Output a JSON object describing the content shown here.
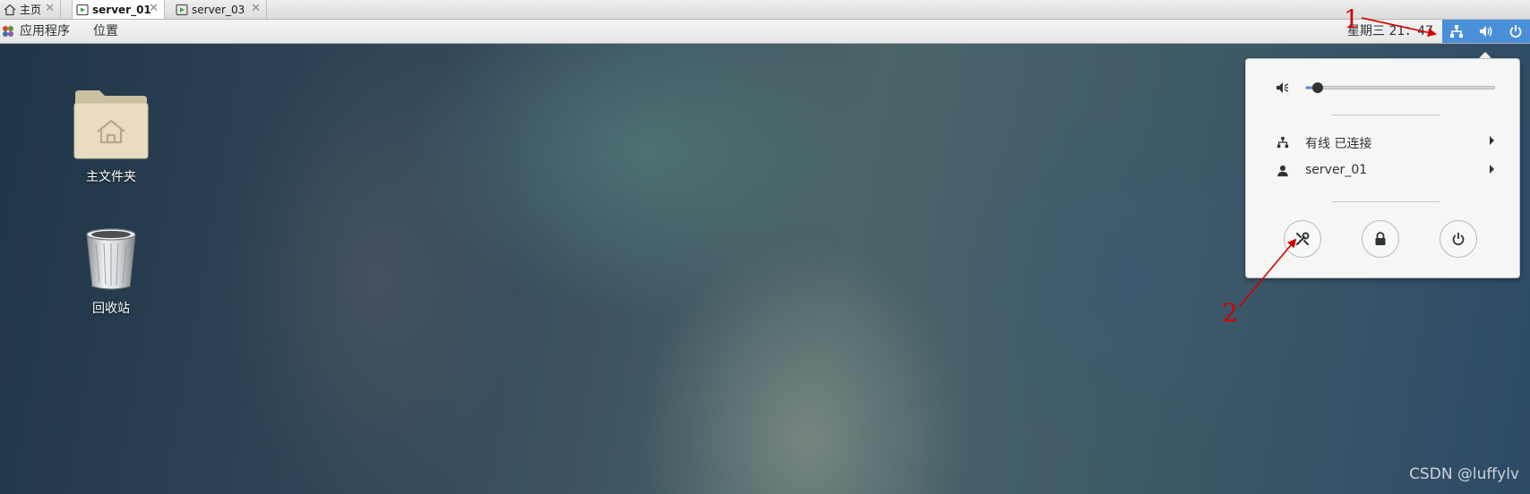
{
  "vm_tabs": [
    {
      "label": "主页",
      "icon": "home-icon",
      "active": false
    },
    {
      "label": "server_01",
      "icon": "vm-icon",
      "active": true
    },
    {
      "label": "server_03",
      "icon": "vm-icon",
      "active": false
    }
  ],
  "close_glyph": "✕",
  "topbar": {
    "applications_label": "应用程序",
    "places_label": "位置",
    "clock": "星期三 21：47",
    "status_icons": [
      "network-wired-icon",
      "volume-icon",
      "power-icon"
    ]
  },
  "desktop": {
    "icons": [
      {
        "label": "主文件夹",
        "icon": "home-folder-icon"
      },
      {
        "label": "回收站",
        "icon": "trash-icon"
      }
    ],
    "watermark": "CSDN @luffylv"
  },
  "annotations": {
    "marker_1": "1",
    "marker_2": "2",
    "color": "#d10000"
  },
  "system_menu": {
    "volume_level": 0.06,
    "network_label": "有线 已连接",
    "user_label": "server_01",
    "buttons": [
      "settings-icon",
      "lock-icon",
      "power-off-icon"
    ]
  },
  "colors": {
    "accent": "#4a90d9",
    "status_area": "#4a90d9"
  }
}
